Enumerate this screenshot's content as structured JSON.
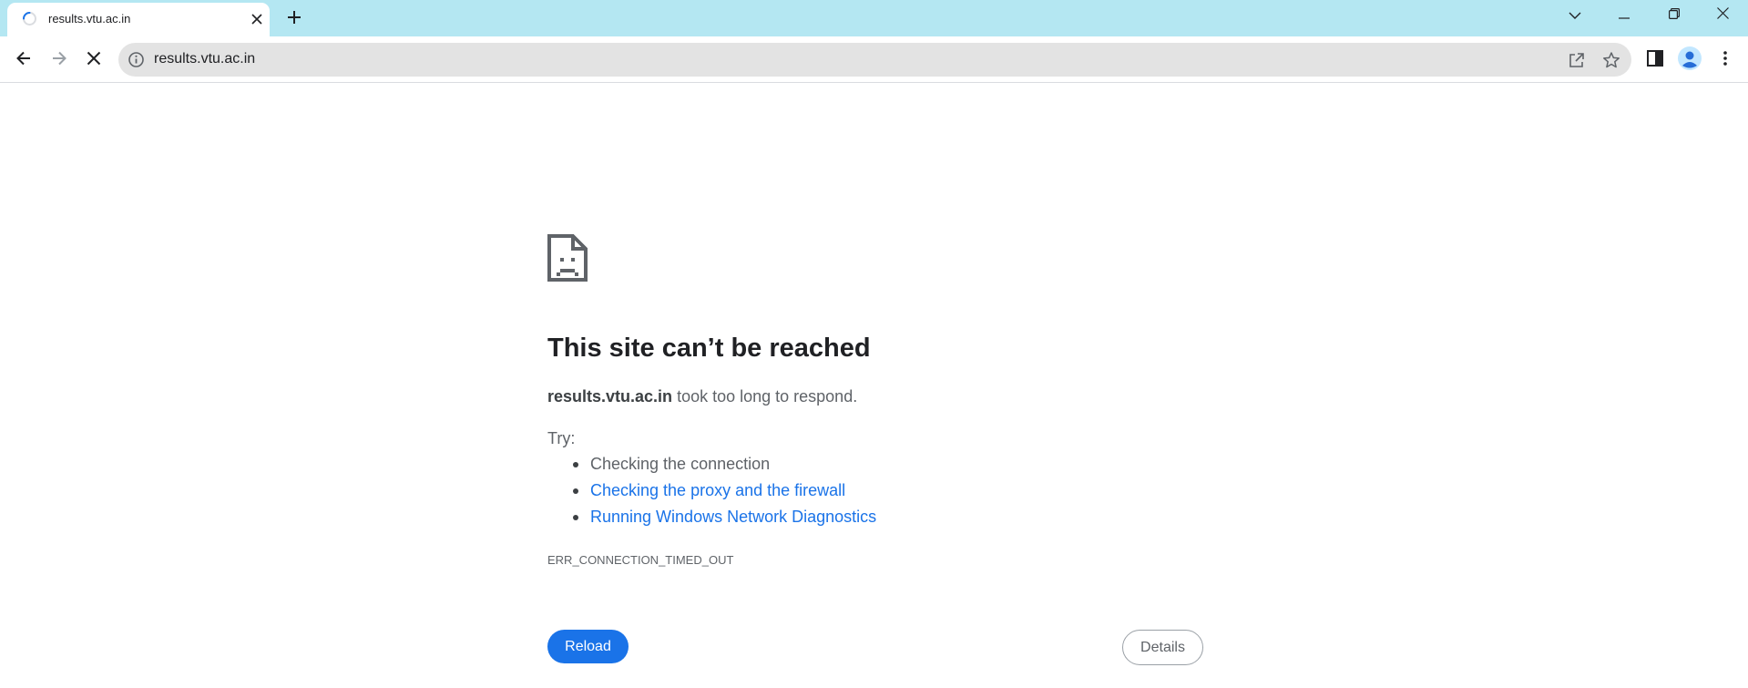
{
  "browser": {
    "tab": {
      "title": "results.vtu.ac.in"
    },
    "omnibox": {
      "url": "results.vtu.ac.in"
    },
    "colors": {
      "tabstrip": "#b4e7f2",
      "omnibox": "#e3e3e3",
      "accent": "#1a73e8"
    },
    "icons": {
      "tab_loading": "loading-spinner-icon",
      "tab_close": "close-icon",
      "new_tab": "plus-icon",
      "tab_search": "chevron-down-icon",
      "minimize": "minimize-icon",
      "restore": "restore-icon",
      "close_window": "close-icon",
      "back": "arrow-left-icon",
      "forward": "arrow-right-icon",
      "stop": "stop-x-icon",
      "site_info": "info-icon",
      "share": "share-icon",
      "bookmark": "star-icon",
      "side_panel": "side-panel-icon",
      "profile": "profile-avatar-icon",
      "menu": "kebab-menu-icon"
    }
  },
  "error_page": {
    "icon": "sad-page-icon",
    "title": "This site can’t be reached",
    "host": "results.vtu.ac.in",
    "description_suffix": " took too long to respond.",
    "try_label": "Try:",
    "suggestions": [
      {
        "text": "Checking the connection",
        "link": false
      },
      {
        "text": "Checking the proxy and the firewall",
        "link": true
      },
      {
        "text": "Running Windows Network Diagnostics",
        "link": true
      }
    ],
    "error_code": "ERR_CONNECTION_TIMED_OUT",
    "reload_label": "Reload",
    "details_label": "Details"
  }
}
